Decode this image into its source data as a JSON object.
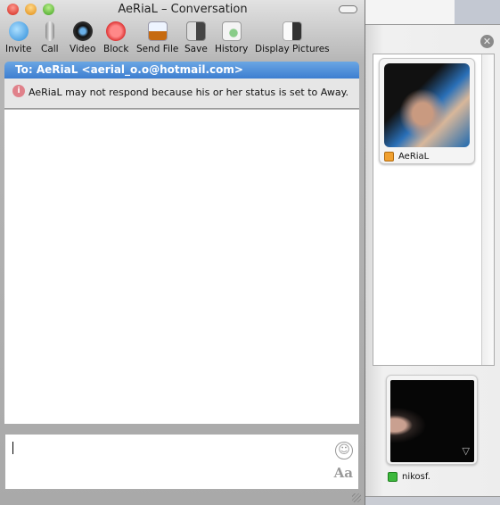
{
  "window": {
    "title": "AeRiaL – Conversation"
  },
  "toolbar": [
    {
      "label": "Invite",
      "icon": "invite-icon"
    },
    {
      "label": "Call",
      "icon": "microphone-icon"
    },
    {
      "label": "Video",
      "icon": "camera-icon"
    },
    {
      "label": "Block",
      "icon": "block-icon"
    },
    {
      "label": "Send File",
      "icon": "send-file-icon"
    },
    {
      "label": "Save",
      "icon": "save-icon"
    },
    {
      "label": "History",
      "icon": "history-icon"
    },
    {
      "label": "Display Pictures",
      "icon": "display-pictures-icon"
    }
  ],
  "conversation": {
    "to": "To: AeRiaL <aerial_o.o@hotmail.com>",
    "notice": "AeRiaL may not respond because his or her status is set to Away.",
    "input_value": "",
    "font_button": "Aa"
  },
  "drawer": {
    "contact": {
      "name": "AeRiaL",
      "status": "away",
      "status_color": "#f0a030"
    },
    "self": {
      "name": "nikosf.",
      "status": "online",
      "status_color": "#3cb83c"
    }
  }
}
